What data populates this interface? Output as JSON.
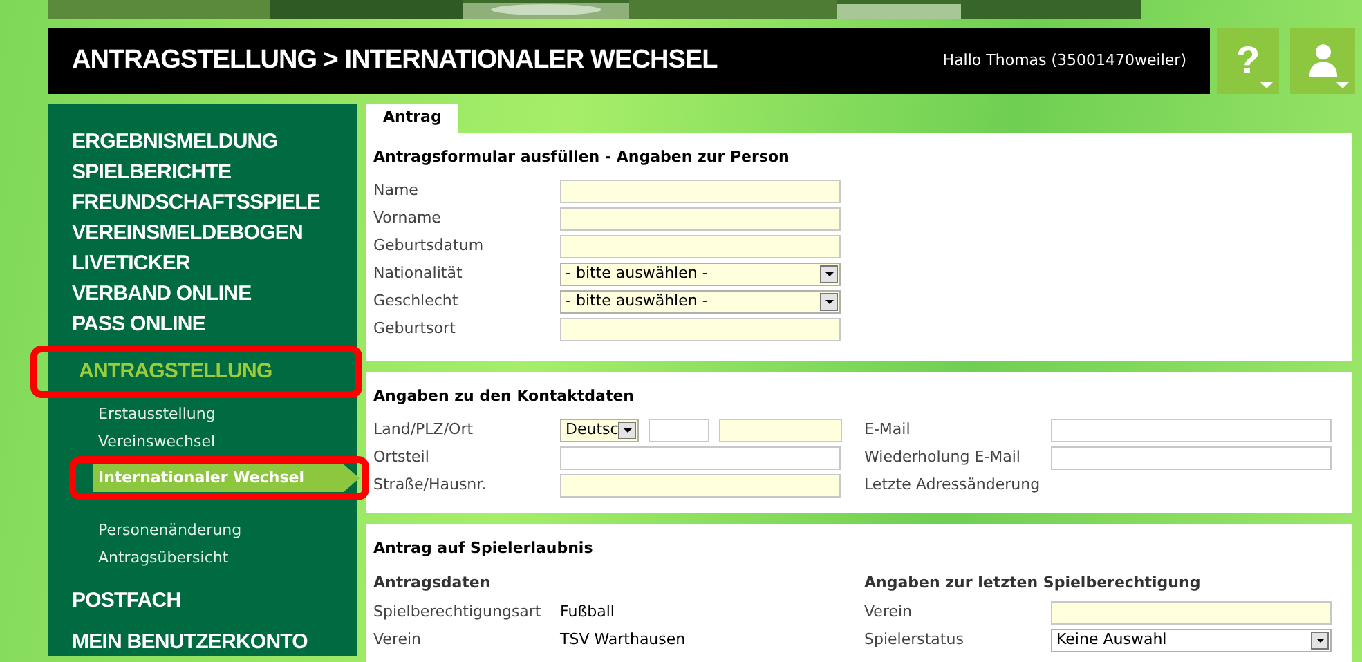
{
  "header": {
    "title": "ANTRAGSTELLUNG > INTERNATIONALER WECHSEL",
    "greeting": "Hallo Thomas (35001470weiler)",
    "help_label": "?"
  },
  "sidebar": {
    "items": [
      {
        "label": "ERGEBNISMELDUNG",
        "selected": false,
        "highlighted": false
      },
      {
        "label": "SPIELBERICHTE",
        "selected": false,
        "highlighted": false
      },
      {
        "label": "FREUNDSCHAFTSSPIELE",
        "selected": false,
        "highlighted": false
      },
      {
        "label": "VEREINSMELDEBOGEN",
        "selected": false,
        "highlighted": false
      },
      {
        "label": "LIVETICKER",
        "selected": false,
        "highlighted": false
      },
      {
        "label": "VERBAND ONLINE",
        "selected": false,
        "highlighted": false
      },
      {
        "label": "PASS ONLINE",
        "selected": false,
        "highlighted": false
      },
      {
        "label": "ANTRAGSTELLUNG",
        "selected": true,
        "highlighted": true,
        "children": [
          {
            "label": "Erstausstellung",
            "selected": false,
            "highlighted": false
          },
          {
            "label": "Vereinswechsel",
            "selected": false,
            "highlighted": false
          },
          {
            "label": "Internationaler Wechsel",
            "selected": true,
            "highlighted": true
          },
          {
            "label": "Personenänderung",
            "selected": false,
            "highlighted": false
          },
          {
            "label": "Antragsübersicht",
            "selected": false,
            "highlighted": false
          }
        ]
      },
      {
        "label": "POSTFACH",
        "selected": false,
        "highlighted": false
      },
      {
        "label": "MEIN BENUTZERKONTO",
        "selected": false,
        "highlighted": false
      }
    ]
  },
  "tabs": [
    {
      "label": "Antrag",
      "selected": true
    }
  ],
  "sections": [
    {
      "title": "Antragsformular ausfüllen - Angaben zur Person",
      "rows": [
        {
          "label": "Name",
          "field": {
            "kind": "text",
            "required": true
          }
        },
        {
          "label": "Vorname",
          "field": {
            "kind": "text",
            "required": true
          }
        },
        {
          "label": "Geburtsdatum",
          "field": {
            "kind": "text",
            "required": true
          }
        },
        {
          "label": "Nationalität",
          "field": {
            "kind": "select",
            "required": true,
            "value": "- bitte auswählen -"
          }
        },
        {
          "label": "Geschlecht",
          "field": {
            "kind": "select",
            "required": true,
            "value": "- bitte auswählen -"
          }
        },
        {
          "label": "Geburtsort",
          "field": {
            "kind": "text",
            "required": true
          }
        }
      ]
    },
    {
      "title": "Angaben zu den Kontaktdaten",
      "columns": [
        {
          "rows": [
            {
              "label": "Land/PLZ/Ort",
              "field": {
                "kind": "composite",
                "parts": [
                  {
                    "kind": "select",
                    "required": true,
                    "value": "Deutsc"
                  },
                  {
                    "kind": "text",
                    "required": false
                  },
                  {
                    "kind": "text",
                    "required": true
                  }
                ]
              }
            },
            {
              "label": "Ortsteil",
              "field": {
                "kind": "text",
                "required": false
              }
            },
            {
              "label": "Straße/Hausnr.",
              "field": {
                "kind": "text",
                "required": true
              }
            }
          ]
        },
        {
          "rows": [
            {
              "label": "E-Mail",
              "field": {
                "kind": "text",
                "required": false
              }
            },
            {
              "label": "Wiederholung E-Mail",
              "field": {
                "kind": "text",
                "required": false
              }
            },
            {
              "label": "Letzte Adressänderung",
              "field": {
                "kind": "none"
              }
            }
          ]
        }
      ]
    },
    {
      "title": "Antrag auf Spielerlaubnis",
      "columns": [
        {
          "heading": "Antragsdaten",
          "rows": [
            {
              "label": "Spielberechtigungsart",
              "field": {
                "kind": "value",
                "value": "Fußball"
              }
            },
            {
              "label": "Verein",
              "field": {
                "kind": "value",
                "value": "TSV Warthausen"
              }
            }
          ]
        },
        {
          "heading": "Angaben zur letzten Spielberechtigung",
          "rows": [
            {
              "label": "Verein",
              "field": {
                "kind": "text",
                "required": true
              }
            },
            {
              "label": "Spielerstatus",
              "field": {
                "kind": "select",
                "required": false,
                "value": "Keine Auswahl"
              }
            }
          ]
        }
      ]
    }
  ]
}
